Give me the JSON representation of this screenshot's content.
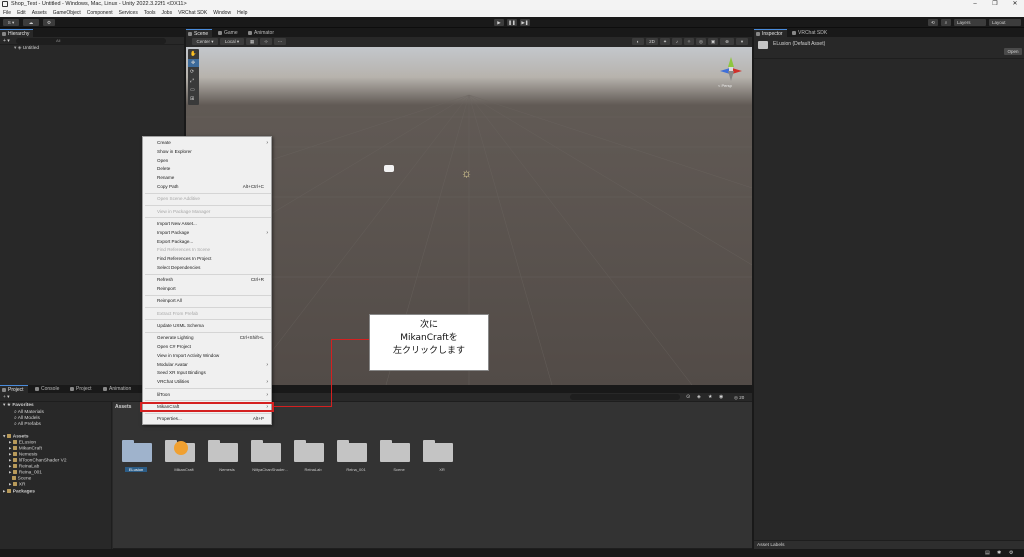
{
  "window": {
    "title": "Shop_Test - Untitled - Windows, Mac, Linux - Unity 2022.3.22f1 <DX11>",
    "minimize": "–",
    "maximize": "❐",
    "close": "✕"
  },
  "menubar": [
    "File",
    "Edit",
    "Assets",
    "GameObject",
    "Component",
    "Services",
    "Tools",
    "Jobs",
    "VRChat SDK",
    "Window",
    "Help"
  ],
  "toolbar": {
    "account_label": "S",
    "layers_label": "Layers",
    "layout_label": "Layout"
  },
  "hierarchy": {
    "tab_label": "Hierarchy",
    "search_placeholder": "All",
    "root_item": "Untitled"
  },
  "scene": {
    "tabs": [
      "Scene",
      "Game",
      "Animator"
    ],
    "pivot_label": "Center",
    "space_label": "Local",
    "view_2d_label": "2D",
    "persp_label": "< Persp"
  },
  "inspector": {
    "tabs": [
      "Inspector",
      "VRChat SDK"
    ],
    "asset_name": "ELusion (Default Asset)",
    "open_button": "Open",
    "asset_labels": "Asset Labels"
  },
  "project": {
    "tabs": [
      "Project",
      "Console",
      "Project",
      "Animation"
    ],
    "add_label": "+ ▾",
    "breadcrumb": "Assets",
    "favorites_label": "Favorites",
    "favorites": [
      "All Materials",
      "All Models",
      "All Prefabs"
    ],
    "assets_label": "Assets",
    "asset_folders_tree": [
      "ELusion",
      "MikanCraft",
      "Nemesis",
      "lilToonChanShader V2",
      "ReinaLab",
      "Reina_001",
      "Scene",
      "XR"
    ],
    "packages_label": "Packages",
    "grid_assets": [
      "ELusion",
      "MikanCraft",
      "Nemesis",
      "NiityaChanShader...",
      "ReinaLab",
      "Reina_001",
      "Scene",
      "XR"
    ],
    "selected_asset": "ELusion",
    "footer_path": "Assets/ELusion",
    "zoom_count": "20"
  },
  "context_menu": {
    "items": [
      {
        "label": "Create",
        "submenu": true
      },
      {
        "label": "Show in Explorer"
      },
      {
        "label": "Open"
      },
      {
        "label": "Delete"
      },
      {
        "label": "Rename"
      },
      {
        "label": "Copy Path",
        "shortcut": "Alt+Ctrl+C"
      },
      {
        "separator": true
      },
      {
        "label": "Open Scene Additive",
        "disabled": true
      },
      {
        "separator": true
      },
      {
        "label": "View in Package Manager",
        "disabled": true
      },
      {
        "separator": true
      },
      {
        "label": "Import New Asset..."
      },
      {
        "label": "Import Package",
        "submenu": true
      },
      {
        "label": "Export Package..."
      },
      {
        "label": "Find References In Scene",
        "disabled": true
      },
      {
        "label": "Find References In Project"
      },
      {
        "label": "Select Dependencies"
      },
      {
        "separator": true
      },
      {
        "label": "Refresh",
        "shortcut": "Ctrl+R"
      },
      {
        "label": "Reimport"
      },
      {
        "separator": true
      },
      {
        "label": "Reimport All"
      },
      {
        "separator": true
      },
      {
        "label": "Extract From Prefab",
        "disabled": true
      },
      {
        "separator": true
      },
      {
        "label": "Update UXML Schema"
      },
      {
        "separator": true
      },
      {
        "label": "Generate Lighting",
        "shortcut": "Ctrl+Shift+L"
      },
      {
        "label": "Open C# Project"
      },
      {
        "label": "View in Import Activity Window"
      },
      {
        "label": "Modular Avatar",
        "submenu": true
      },
      {
        "label": "Seed XR Input Bindings"
      },
      {
        "label": "VRChat Utilities",
        "submenu": true
      },
      {
        "separator": true
      },
      {
        "label": "lilToon",
        "submenu": true
      },
      {
        "separator": true
      },
      {
        "label": "MikanCraft",
        "submenu": true,
        "highlighted": true
      },
      {
        "separator": true
      },
      {
        "label": "Properties...",
        "shortcut": "Alt+P"
      }
    ]
  },
  "callout": {
    "line1": "次に",
    "line2": "MikanCraftを",
    "line3": "左クリックします"
  },
  "colors": {
    "highlight": "#d42020",
    "panel": "#282828",
    "selection": "#2c5d87"
  }
}
